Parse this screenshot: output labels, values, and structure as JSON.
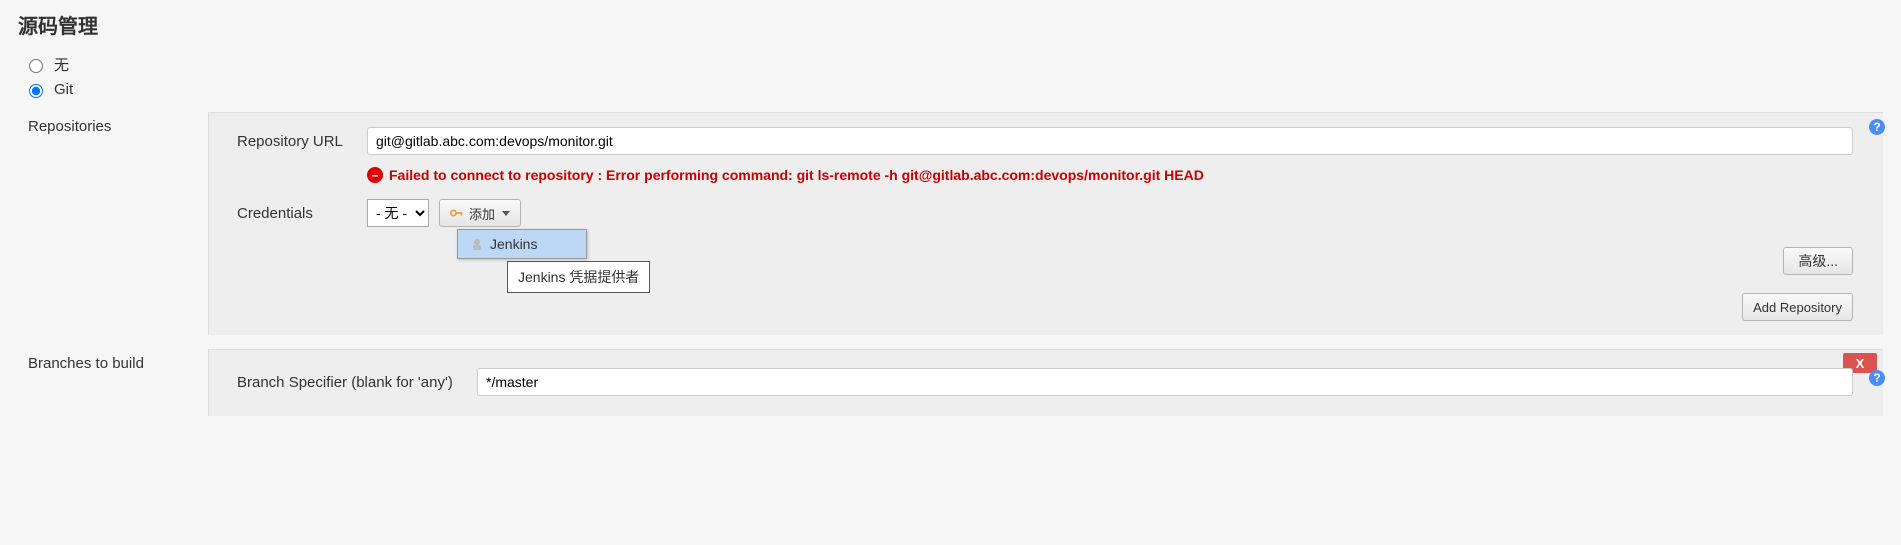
{
  "section": {
    "title": "源码管理"
  },
  "scm": {
    "options": {
      "none": "无",
      "git": "Git"
    },
    "selected": "git"
  },
  "repositories": {
    "label": "Repositories",
    "repo_url": {
      "label": "Repository URL",
      "value": "git@gitlab.abc.com:devops/monitor.git"
    },
    "error": "Failed to connect to repository : Error performing command: git ls-remote -h git@gitlab.abc.com:devops/monitor.git HEAD",
    "credentials": {
      "label": "Credentials",
      "selected": "- 无 -",
      "add_label": "添加",
      "dropdown_item": "Jenkins",
      "tooltip": "Jenkins 凭据提供者"
    },
    "advanced_label": "高级...",
    "add_repo_label": "Add Repository"
  },
  "branches": {
    "label": "Branches to build",
    "specifier": {
      "label": "Branch Specifier (blank for 'any')",
      "value": "*/master"
    },
    "close": "X"
  }
}
